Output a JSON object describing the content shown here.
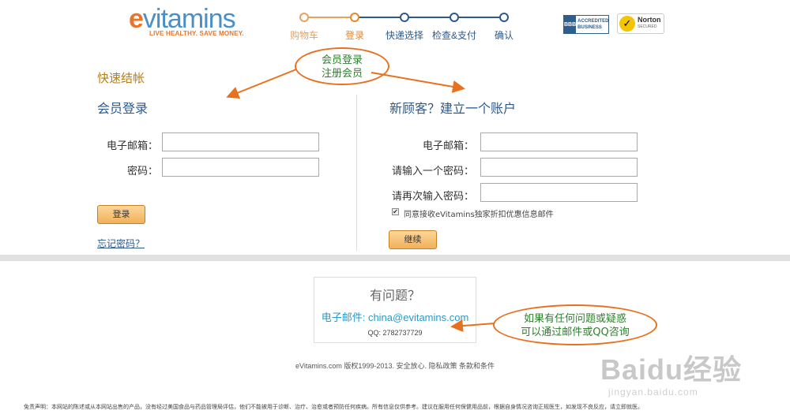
{
  "header": {
    "logo": {
      "e": "e",
      "rest": "vitamins",
      "tagline": "LIVE HEALTHY. SAVE MONEY."
    },
    "steps": [
      {
        "label": "购物车",
        "color": "#e8a060",
        "dot": "#e8a060"
      },
      {
        "label": "登录",
        "color": "#e8872e",
        "dot": "#e8872e"
      },
      {
        "label": "快递选择",
        "color": "#2c5a8b",
        "dot": "#2c5a8b"
      },
      {
        "label": "检查&支付",
        "color": "#2c5a8b",
        "dot": "#2c5a8b"
      },
      {
        "label": "确认",
        "color": "#2c5a8b",
        "dot": "#2c5a8b"
      }
    ],
    "bbb": {
      "logo": "BBB",
      "line1": "ACCREDITED",
      "line2": "BUSINESS"
    },
    "norton": {
      "name": "Norton",
      "sub": "SECURED"
    }
  },
  "checkout": {
    "title": "快速结帐",
    "login": {
      "title": "会员登录",
      "email_label": "电子邮箱：",
      "password_label": "密码：",
      "email_value": "",
      "password_value": "",
      "submit_label": "登录",
      "forgot_label": "忘记密码？"
    },
    "register": {
      "title": "新顾客？建立一个账户",
      "email_label": "电子邮箱：",
      "password_label": "请输入一个密码：",
      "confirm_label": "请再次输入密码：",
      "email_value": "",
      "password_value": "",
      "confirm_value": "",
      "consent_checked": true,
      "consent_mark": "✔",
      "consent_label": "同意接收eVitamins独家折扣优惠信息邮件",
      "submit_label": "继续"
    }
  },
  "help": {
    "title": "有问题？",
    "email_prefix": "电子邮件: ",
    "email": "china@evitamins.com",
    "qq": "QQ: 2782737729"
  },
  "footer": {
    "copyright": "eVitamins.com 版权1999-2013. 安全放心. 隐私政策 条款和条件",
    "disclaimer": "免责声明：本网站的陈述或从本网站出售的产品，没有经过美国食品与药品管理局评估，他们不能被用于诊断、治疗、治愈或者预防任何疾病。所有信息仅供参考。建议在服用任何保健用品前，根据自身情况咨询正规医生，如发现不良反应，请立即就医。"
  },
  "annotations": {
    "top_note": [
      "会员登录",
      "注册会员"
    ],
    "bottom_note": [
      "如果有任何问题或疑惑",
      "可以通过邮件或QQ咨询"
    ],
    "color": "#e8711f"
  },
  "watermark": {
    "big": "Baidu经验",
    "small": "jingyan.baidu.com"
  }
}
